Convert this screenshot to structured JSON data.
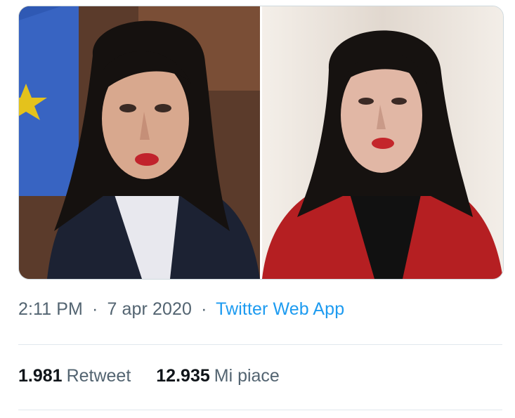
{
  "media": {
    "left_photo_alt": "",
    "right_photo_alt": ""
  },
  "tweet_meta": {
    "time": "2:11 PM",
    "separator": "·",
    "date": "7 apr 2020",
    "separator2": "·",
    "source": "Twitter Web App"
  },
  "stats": {
    "retweets_count": "1.981",
    "retweets_label": "Retweet",
    "likes_count": "12.935",
    "likes_label": "Mi piace"
  },
  "colors": {
    "link": "#1d9bf0",
    "secondary_text": "#536471",
    "primary_text": "#0f1419",
    "divider": "#e1e8ed"
  }
}
